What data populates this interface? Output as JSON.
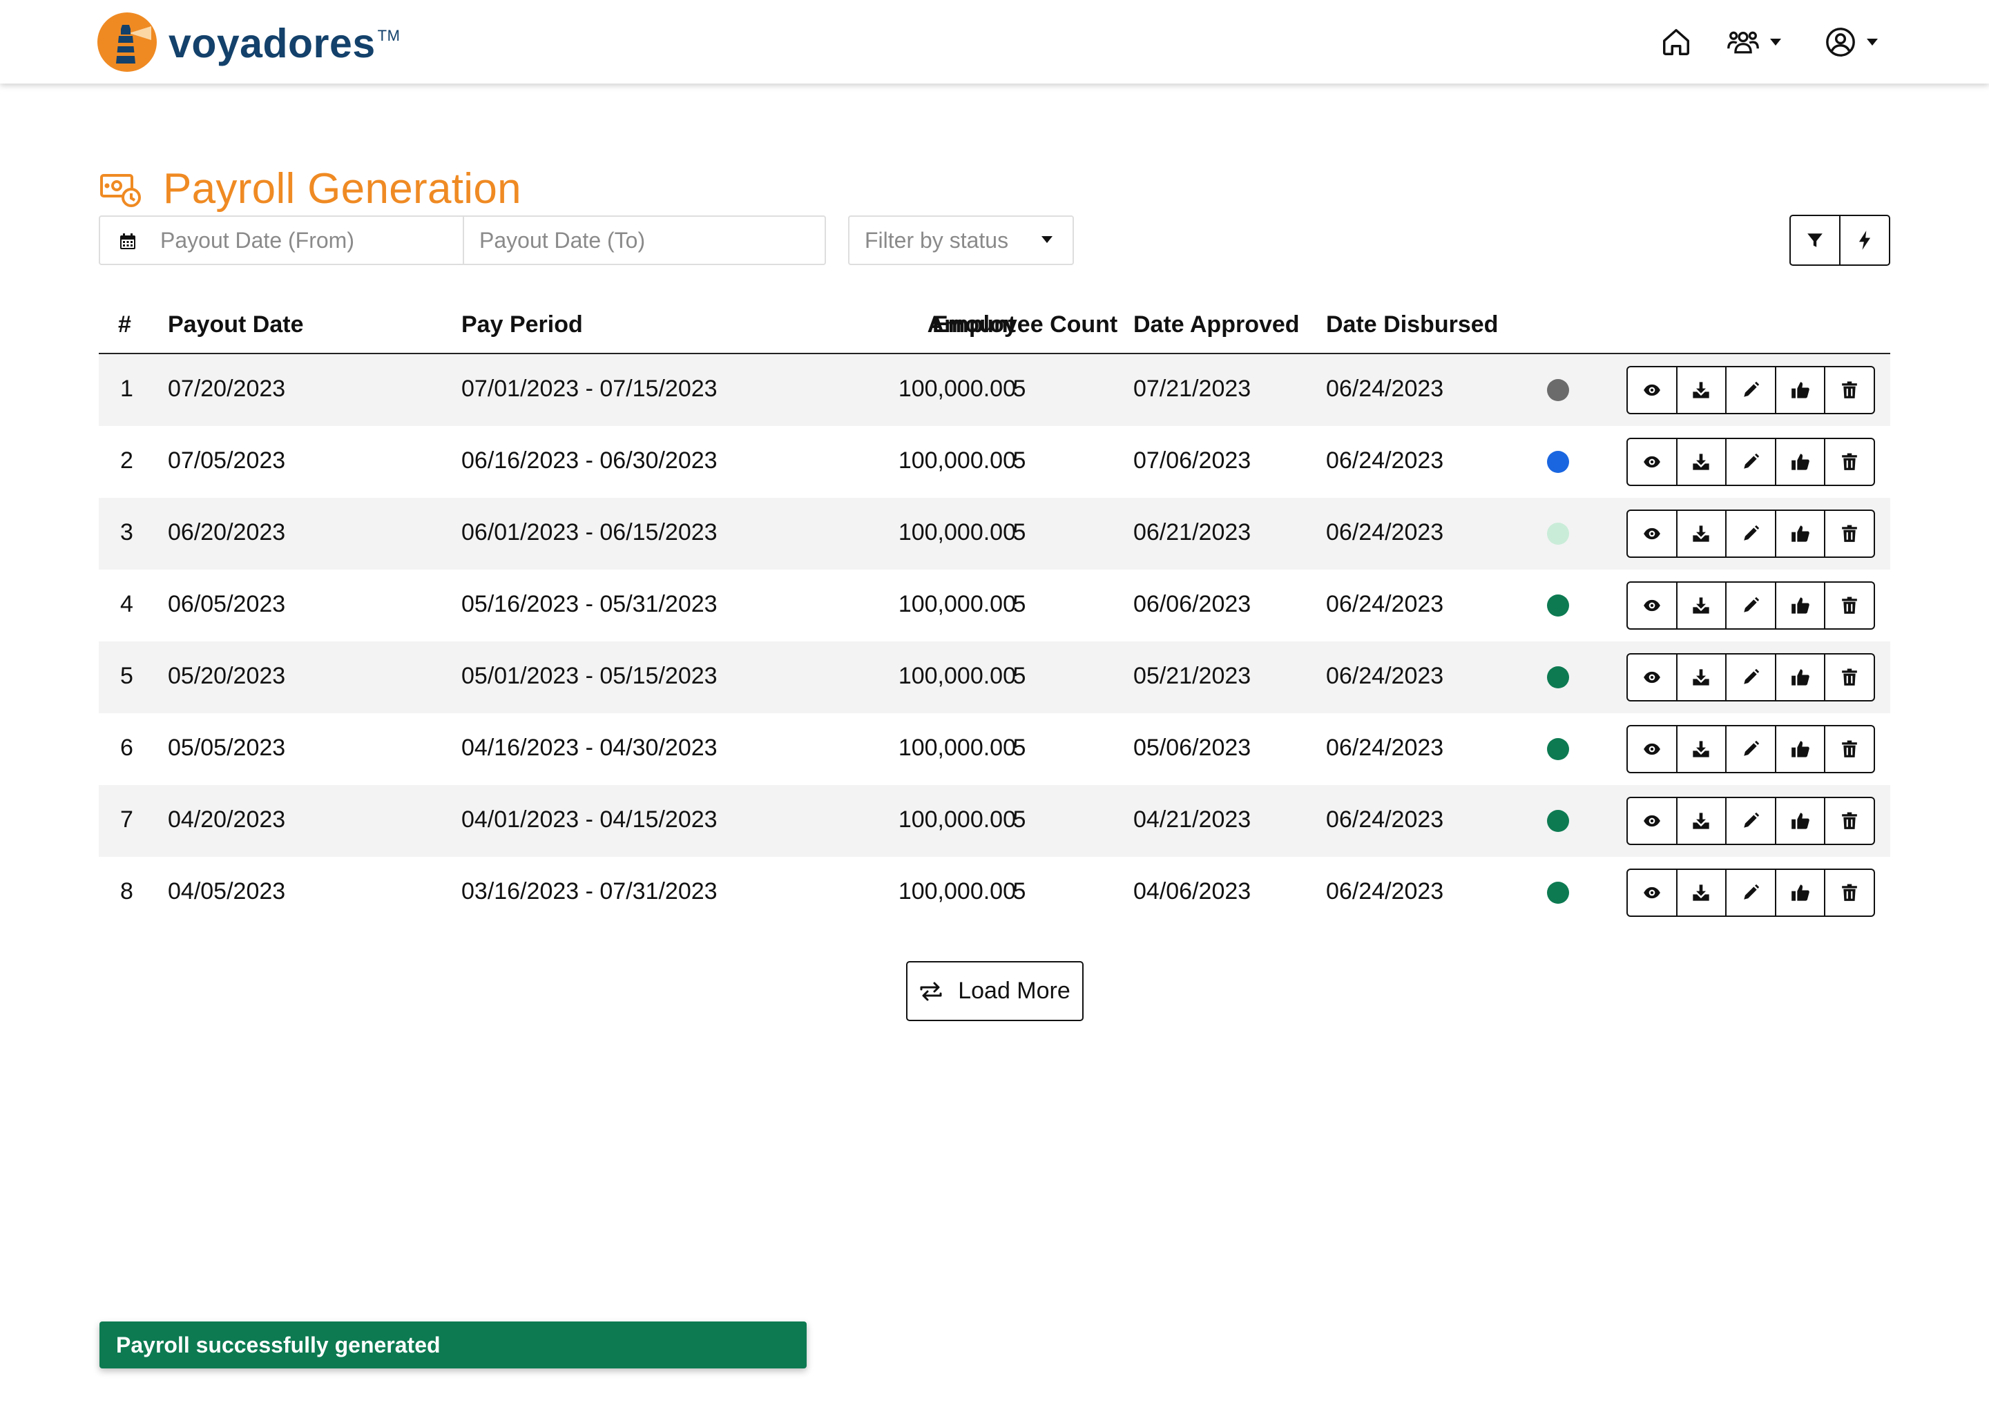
{
  "header": {
    "brand_name": "voyadores",
    "brand_tm": "TM"
  },
  "page": {
    "title": "Payroll Generation"
  },
  "filters": {
    "date_from_placeholder": "Payout Date (From)",
    "date_to_placeholder": "Payout Date (To)",
    "status_placeholder": "Filter by status"
  },
  "table": {
    "headers": {
      "index": "#",
      "payout_date": "Payout Date",
      "pay_period": "Pay Period",
      "amount": "Amount",
      "employee_count": "Employee Count",
      "date_approved": "Date Approved",
      "date_disbursed": "Date Disbursed"
    },
    "rows": [
      {
        "index": "1",
        "payout_date": "07/20/2023",
        "pay_period": "07/01/2023 - 07/15/2023",
        "amount": "100,000.00",
        "employee_count": "5",
        "date_approved": "07/21/2023",
        "date_disbursed": "06/24/2023"
      },
      {
        "index": "2",
        "payout_date": "07/05/2023",
        "pay_period": "06/16/2023 - 06/30/2023",
        "amount": "100,000.00",
        "employee_count": "5",
        "date_approved": "07/06/2023",
        "date_disbursed": "06/24/2023"
      },
      {
        "index": "3",
        "payout_date": "06/20/2023",
        "pay_period": "06/01/2023 - 06/15/2023",
        "amount": "100,000.00",
        "employee_count": "5",
        "date_approved": "06/21/2023",
        "date_disbursed": "06/24/2023"
      },
      {
        "index": "4",
        "payout_date": "06/05/2023",
        "pay_period": "05/16/2023 - 05/31/2023",
        "amount": "100,000.00",
        "employee_count": "5",
        "date_approved": "06/06/2023",
        "date_disbursed": "06/24/2023"
      },
      {
        "index": "5",
        "payout_date": "05/20/2023",
        "pay_period": "05/01/2023 - 05/15/2023",
        "amount": "100,000.00",
        "employee_count": "5",
        "date_approved": "05/21/2023",
        "date_disbursed": "06/24/2023"
      },
      {
        "index": "6",
        "payout_date": "05/05/2023",
        "pay_period": "04/16/2023 - 04/30/2023",
        "amount": "100,000.00",
        "employee_count": "5",
        "date_approved": "05/06/2023",
        "date_disbursed": "06/24/2023"
      },
      {
        "index": "7",
        "payout_date": "04/20/2023",
        "pay_period": "04/01/2023 - 04/15/2023",
        "amount": "100,000.00",
        "employee_count": "5",
        "date_approved": "04/21/2023",
        "date_disbursed": "06/24/2023"
      },
      {
        "index": "8",
        "payout_date": "04/05/2023",
        "pay_period": "03/16/2023 - 07/31/2023",
        "amount": "100,000.00",
        "employee_count": "5",
        "date_approved": "04/06/2023",
        "date_disbursed": "06/24/2023"
      }
    ]
  },
  "status_colors": [
    "#6b6b6b",
    "#1a66e0",
    "#c9ecd8",
    "#0d7a52",
    "#0d7a52",
    "#0d7a52",
    "#0d7a52",
    "#0d7a52"
  ],
  "row_action_icons": [
    "eye-icon",
    "download-icon",
    "pencil-icon",
    "thumbs-up-icon",
    "trash-icon"
  ],
  "load_more_label": "Load More",
  "toast_message": "Payroll successfully generated",
  "colors": {
    "brand_orange": "#ef8a23",
    "brand_navy": "#13416b",
    "success_green": "#0d7a52"
  }
}
